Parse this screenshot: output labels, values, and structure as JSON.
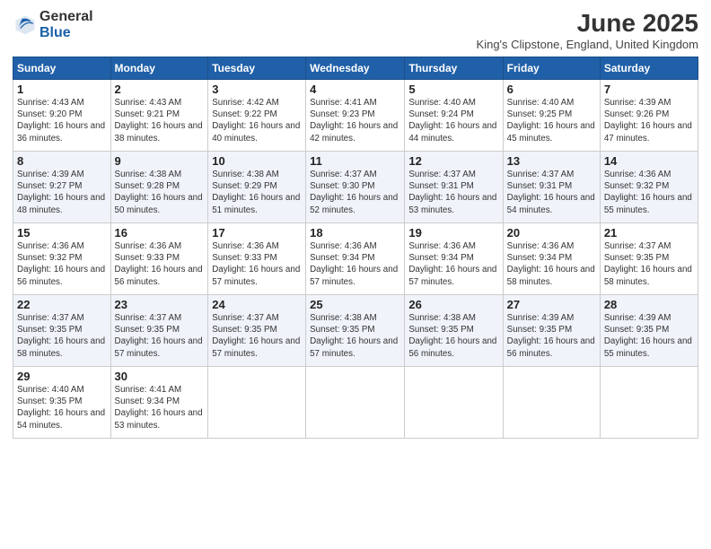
{
  "logo": {
    "general": "General",
    "blue": "Blue"
  },
  "title": "June 2025",
  "location": "King's Clipstone, England, United Kingdom",
  "headers": [
    "Sunday",
    "Monday",
    "Tuesday",
    "Wednesday",
    "Thursday",
    "Friday",
    "Saturday"
  ],
  "weeks": [
    [
      {
        "day": "1",
        "sunrise": "4:43 AM",
        "sunset": "9:20 PM",
        "daylight": "16 hours and 36 minutes."
      },
      {
        "day": "2",
        "sunrise": "4:43 AM",
        "sunset": "9:21 PM",
        "daylight": "16 hours and 38 minutes."
      },
      {
        "day": "3",
        "sunrise": "4:42 AM",
        "sunset": "9:22 PM",
        "daylight": "16 hours and 40 minutes."
      },
      {
        "day": "4",
        "sunrise": "4:41 AM",
        "sunset": "9:23 PM",
        "daylight": "16 hours and 42 minutes."
      },
      {
        "day": "5",
        "sunrise": "4:40 AM",
        "sunset": "9:24 PM",
        "daylight": "16 hours and 44 minutes."
      },
      {
        "day": "6",
        "sunrise": "4:40 AM",
        "sunset": "9:25 PM",
        "daylight": "16 hours and 45 minutes."
      },
      {
        "day": "7",
        "sunrise": "4:39 AM",
        "sunset": "9:26 PM",
        "daylight": "16 hours and 47 minutes."
      }
    ],
    [
      {
        "day": "8",
        "sunrise": "4:39 AM",
        "sunset": "9:27 PM",
        "daylight": "16 hours and 48 minutes."
      },
      {
        "day": "9",
        "sunrise": "4:38 AM",
        "sunset": "9:28 PM",
        "daylight": "16 hours and 50 minutes."
      },
      {
        "day": "10",
        "sunrise": "4:38 AM",
        "sunset": "9:29 PM",
        "daylight": "16 hours and 51 minutes."
      },
      {
        "day": "11",
        "sunrise": "4:37 AM",
        "sunset": "9:30 PM",
        "daylight": "16 hours and 52 minutes."
      },
      {
        "day": "12",
        "sunrise": "4:37 AM",
        "sunset": "9:31 PM",
        "daylight": "16 hours and 53 minutes."
      },
      {
        "day": "13",
        "sunrise": "4:37 AM",
        "sunset": "9:31 PM",
        "daylight": "16 hours and 54 minutes."
      },
      {
        "day": "14",
        "sunrise": "4:36 AM",
        "sunset": "9:32 PM",
        "daylight": "16 hours and 55 minutes."
      }
    ],
    [
      {
        "day": "15",
        "sunrise": "4:36 AM",
        "sunset": "9:32 PM",
        "daylight": "16 hours and 56 minutes."
      },
      {
        "day": "16",
        "sunrise": "4:36 AM",
        "sunset": "9:33 PM",
        "daylight": "16 hours and 56 minutes."
      },
      {
        "day": "17",
        "sunrise": "4:36 AM",
        "sunset": "9:33 PM",
        "daylight": "16 hours and 57 minutes."
      },
      {
        "day": "18",
        "sunrise": "4:36 AM",
        "sunset": "9:34 PM",
        "daylight": "16 hours and 57 minutes."
      },
      {
        "day": "19",
        "sunrise": "4:36 AM",
        "sunset": "9:34 PM",
        "daylight": "16 hours and 57 minutes."
      },
      {
        "day": "20",
        "sunrise": "4:36 AM",
        "sunset": "9:34 PM",
        "daylight": "16 hours and 58 minutes."
      },
      {
        "day": "21",
        "sunrise": "4:37 AM",
        "sunset": "9:35 PM",
        "daylight": "16 hours and 58 minutes."
      }
    ],
    [
      {
        "day": "22",
        "sunrise": "4:37 AM",
        "sunset": "9:35 PM",
        "daylight": "16 hours and 58 minutes."
      },
      {
        "day": "23",
        "sunrise": "4:37 AM",
        "sunset": "9:35 PM",
        "daylight": "16 hours and 57 minutes."
      },
      {
        "day": "24",
        "sunrise": "4:37 AM",
        "sunset": "9:35 PM",
        "daylight": "16 hours and 57 minutes."
      },
      {
        "day": "25",
        "sunrise": "4:38 AM",
        "sunset": "9:35 PM",
        "daylight": "16 hours and 57 minutes."
      },
      {
        "day": "26",
        "sunrise": "4:38 AM",
        "sunset": "9:35 PM",
        "daylight": "16 hours and 56 minutes."
      },
      {
        "day": "27",
        "sunrise": "4:39 AM",
        "sunset": "9:35 PM",
        "daylight": "16 hours and 56 minutes."
      },
      {
        "day": "28",
        "sunrise": "4:39 AM",
        "sunset": "9:35 PM",
        "daylight": "16 hours and 55 minutes."
      }
    ],
    [
      {
        "day": "29",
        "sunrise": "4:40 AM",
        "sunset": "9:35 PM",
        "daylight": "16 hours and 54 minutes."
      },
      {
        "day": "30",
        "sunrise": "4:41 AM",
        "sunset": "9:34 PM",
        "daylight": "16 hours and 53 minutes."
      },
      null,
      null,
      null,
      null,
      null
    ]
  ]
}
